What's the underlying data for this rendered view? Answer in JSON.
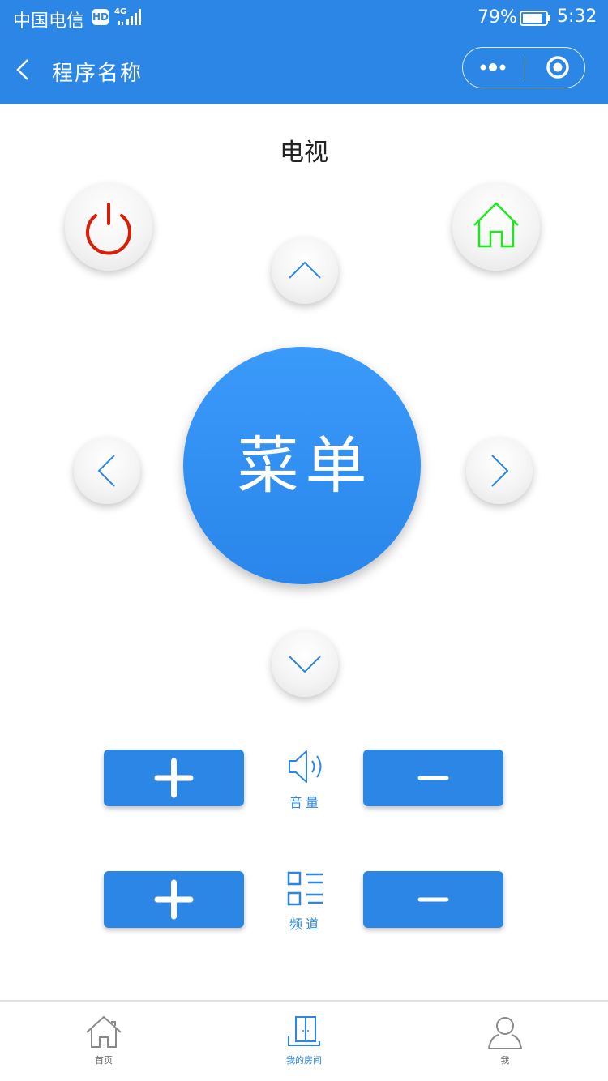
{
  "status_bar": {
    "carrier": "中国电信",
    "hd": "HD",
    "network": "4G",
    "battery": "79%",
    "time": "5:32"
  },
  "nav": {
    "title": "程序名称",
    "back_icon": "chevron-left-icon",
    "more_icon": "more-dots-icon",
    "close_icon": "target-circle-icon"
  },
  "remote": {
    "device_name": "电视",
    "power_icon": "power-icon",
    "home_icon": "home-icon",
    "menu_label": "菜单",
    "volume_label": "音量",
    "channel_label": "频道",
    "colors": {
      "primary": "#2b86e6",
      "power": "#d81e06",
      "home": "#1de81d"
    }
  },
  "tabbar": {
    "items": [
      {
        "label": "首页",
        "icon": "home-outline-icon",
        "active": false
      },
      {
        "label": "我的房间",
        "icon": "door-icon",
        "active": true
      },
      {
        "label": "我",
        "icon": "user-icon",
        "active": false
      }
    ]
  }
}
